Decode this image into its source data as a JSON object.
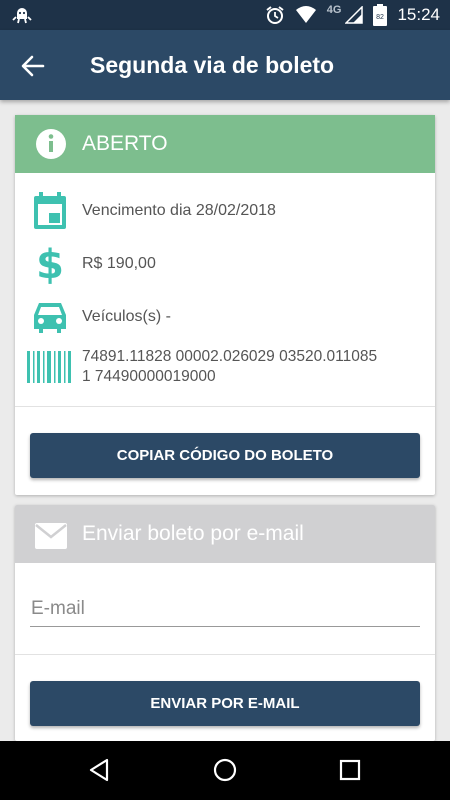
{
  "status_bar": {
    "time": "15:24",
    "network": "4G",
    "icons": [
      "android-debug-icon",
      "alarm-icon",
      "wifi-icon",
      "signal-icon",
      "battery-icon"
    ]
  },
  "app_bar": {
    "title": "Segunda via de boleto"
  },
  "boleto_card": {
    "status": "ABERTO",
    "status_color": "#7dbe8e",
    "vencimento": "Vencimento dia 28/02/2018",
    "valor": "R$ 190,00",
    "veiculos": "Veículos(s)  -",
    "codigo_linha1": "74891.11828 00002.026029 03520.011085",
    "codigo_linha2": "1 74490000019000",
    "copy_button": "COPIAR CÓDIGO DO BOLETO"
  },
  "email_card": {
    "title": "Enviar boleto por e-mail",
    "email_placeholder": "E-mail",
    "send_button": "ENVIAR POR E-MAIL"
  },
  "colors": {
    "primary": "#2c4966",
    "status_bar": "#1e3248",
    "accent": "#3ec1b0"
  }
}
